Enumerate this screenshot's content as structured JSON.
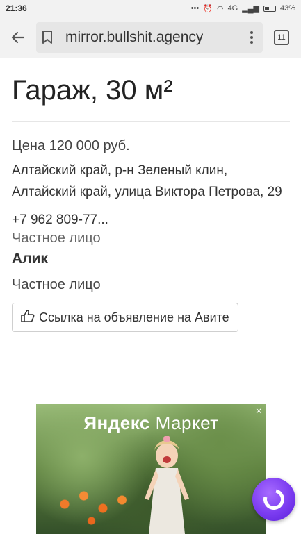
{
  "status_bar": {
    "time": "21:36",
    "network": "4G",
    "battery": "43%"
  },
  "browser": {
    "url": "mirror.bullshit.agency",
    "tab_count": "11"
  },
  "listing": {
    "title": "Гараж, 30 м²",
    "price": "Цена 120 000 руб.",
    "address": "Алтайский край, р-н Зеленый клин, Алтайский край, улица Виктора Петрова, 29",
    "phone": "+7 962 809-77...",
    "seller_type_1": "Частное лицо",
    "seller_name": "Алик",
    "seller_type_2": "Частное лицо",
    "avito_link_label": "Ссылка на объявление на Авите"
  },
  "ad": {
    "logo_part1": "Яндекс",
    "logo_part2": " Маркет",
    "close": "×"
  },
  "icons": {
    "back": "arrow-left-icon",
    "bookmark": "bookmark-icon",
    "menu": "more-vertical-icon",
    "thumb": "thumbs-up-icon",
    "assistant": "alice-icon"
  }
}
